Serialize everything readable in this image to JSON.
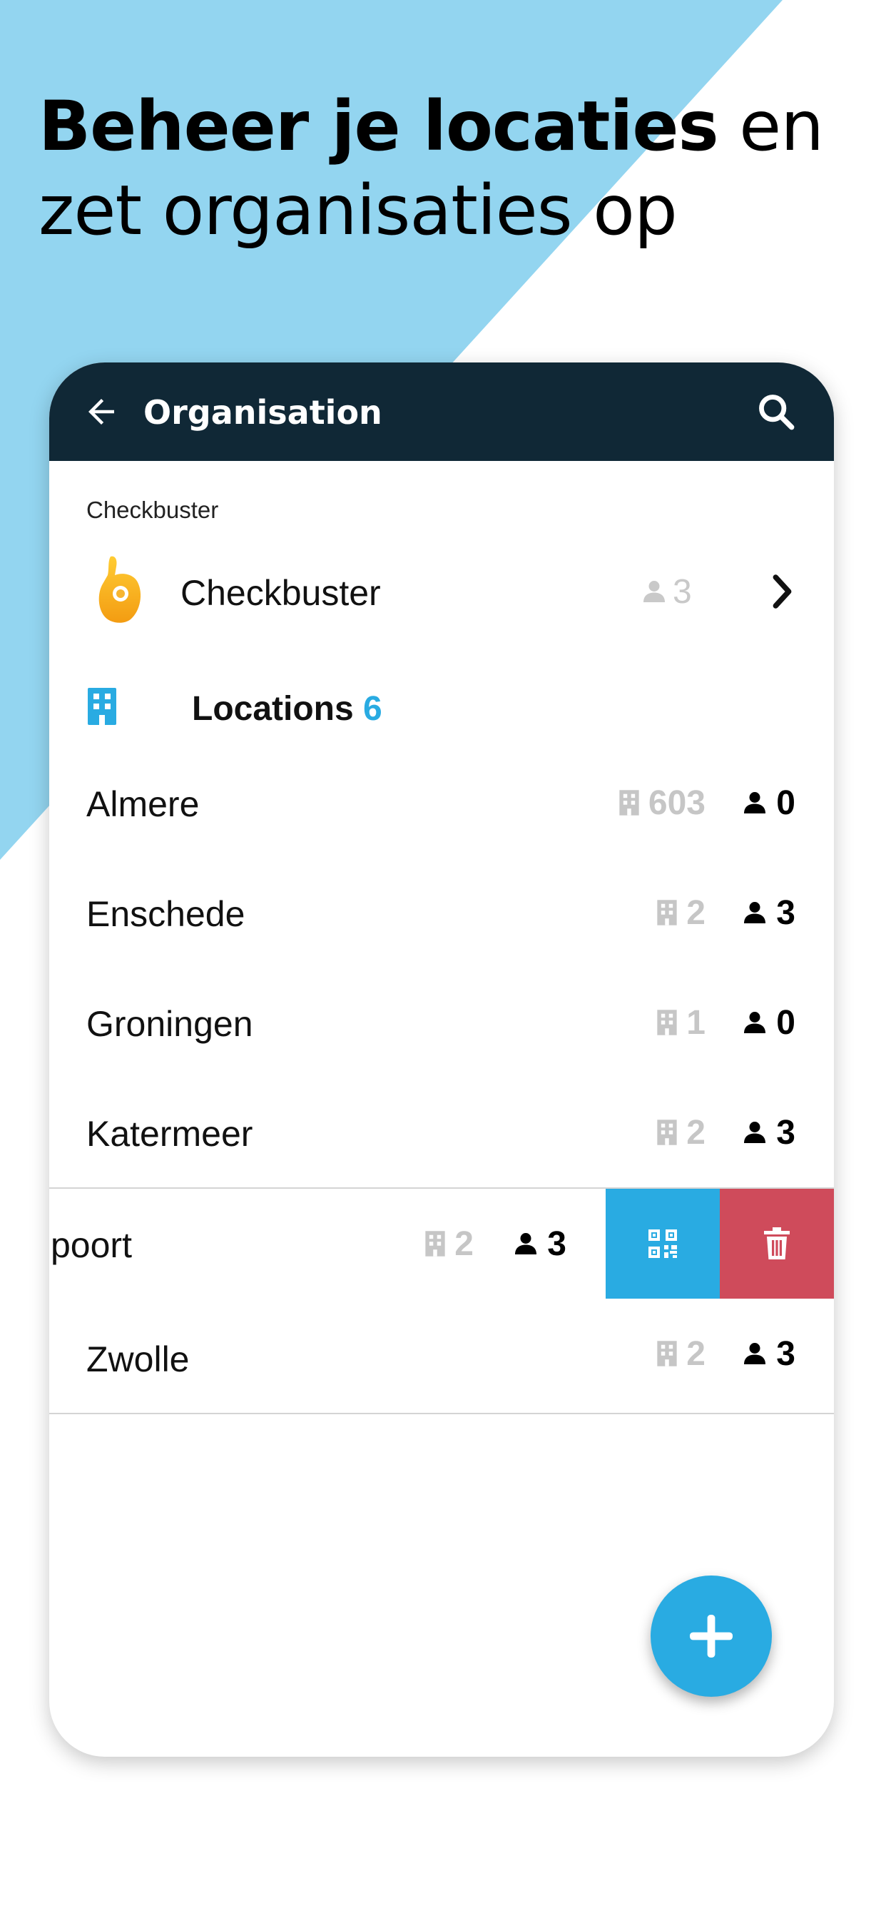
{
  "headline": {
    "bold": "Beheer je locaties",
    "regular": "en zet organisaties op"
  },
  "colors": {
    "accent": "#29abe2",
    "appbar": "#102836",
    "delete": "#cf4b5b",
    "background_triangle": "#93d5f0"
  },
  "appbar": {
    "title": "Organisation",
    "back_icon": "arrow-left-icon",
    "search_icon": "search-icon"
  },
  "organisation": {
    "label": "Checkbuster",
    "name": "Checkbuster",
    "member_count": "3",
    "logo_icon": "ok-hand-icon",
    "chevron_icon": "chevron-right-icon"
  },
  "locations": {
    "title": "Locations",
    "count": "6",
    "items": [
      {
        "name": "Almere",
        "buildings": "603",
        "users": "0"
      },
      {
        "name": "Enschede",
        "buildings": "2",
        "users": "3"
      },
      {
        "name": "Groningen",
        "buildings": "1",
        "users": "0"
      },
      {
        "name": "Katermeer",
        "buildings": "2",
        "users": "3"
      },
      {
        "name": "poort",
        "buildings": "2",
        "users": "3",
        "swiped": true,
        "actions": [
          "qr-code-icon",
          "trash-icon"
        ]
      },
      {
        "name": "Zwolle",
        "buildings": "2",
        "users": "3"
      }
    ]
  },
  "fab": {
    "icon": "plus-icon"
  }
}
